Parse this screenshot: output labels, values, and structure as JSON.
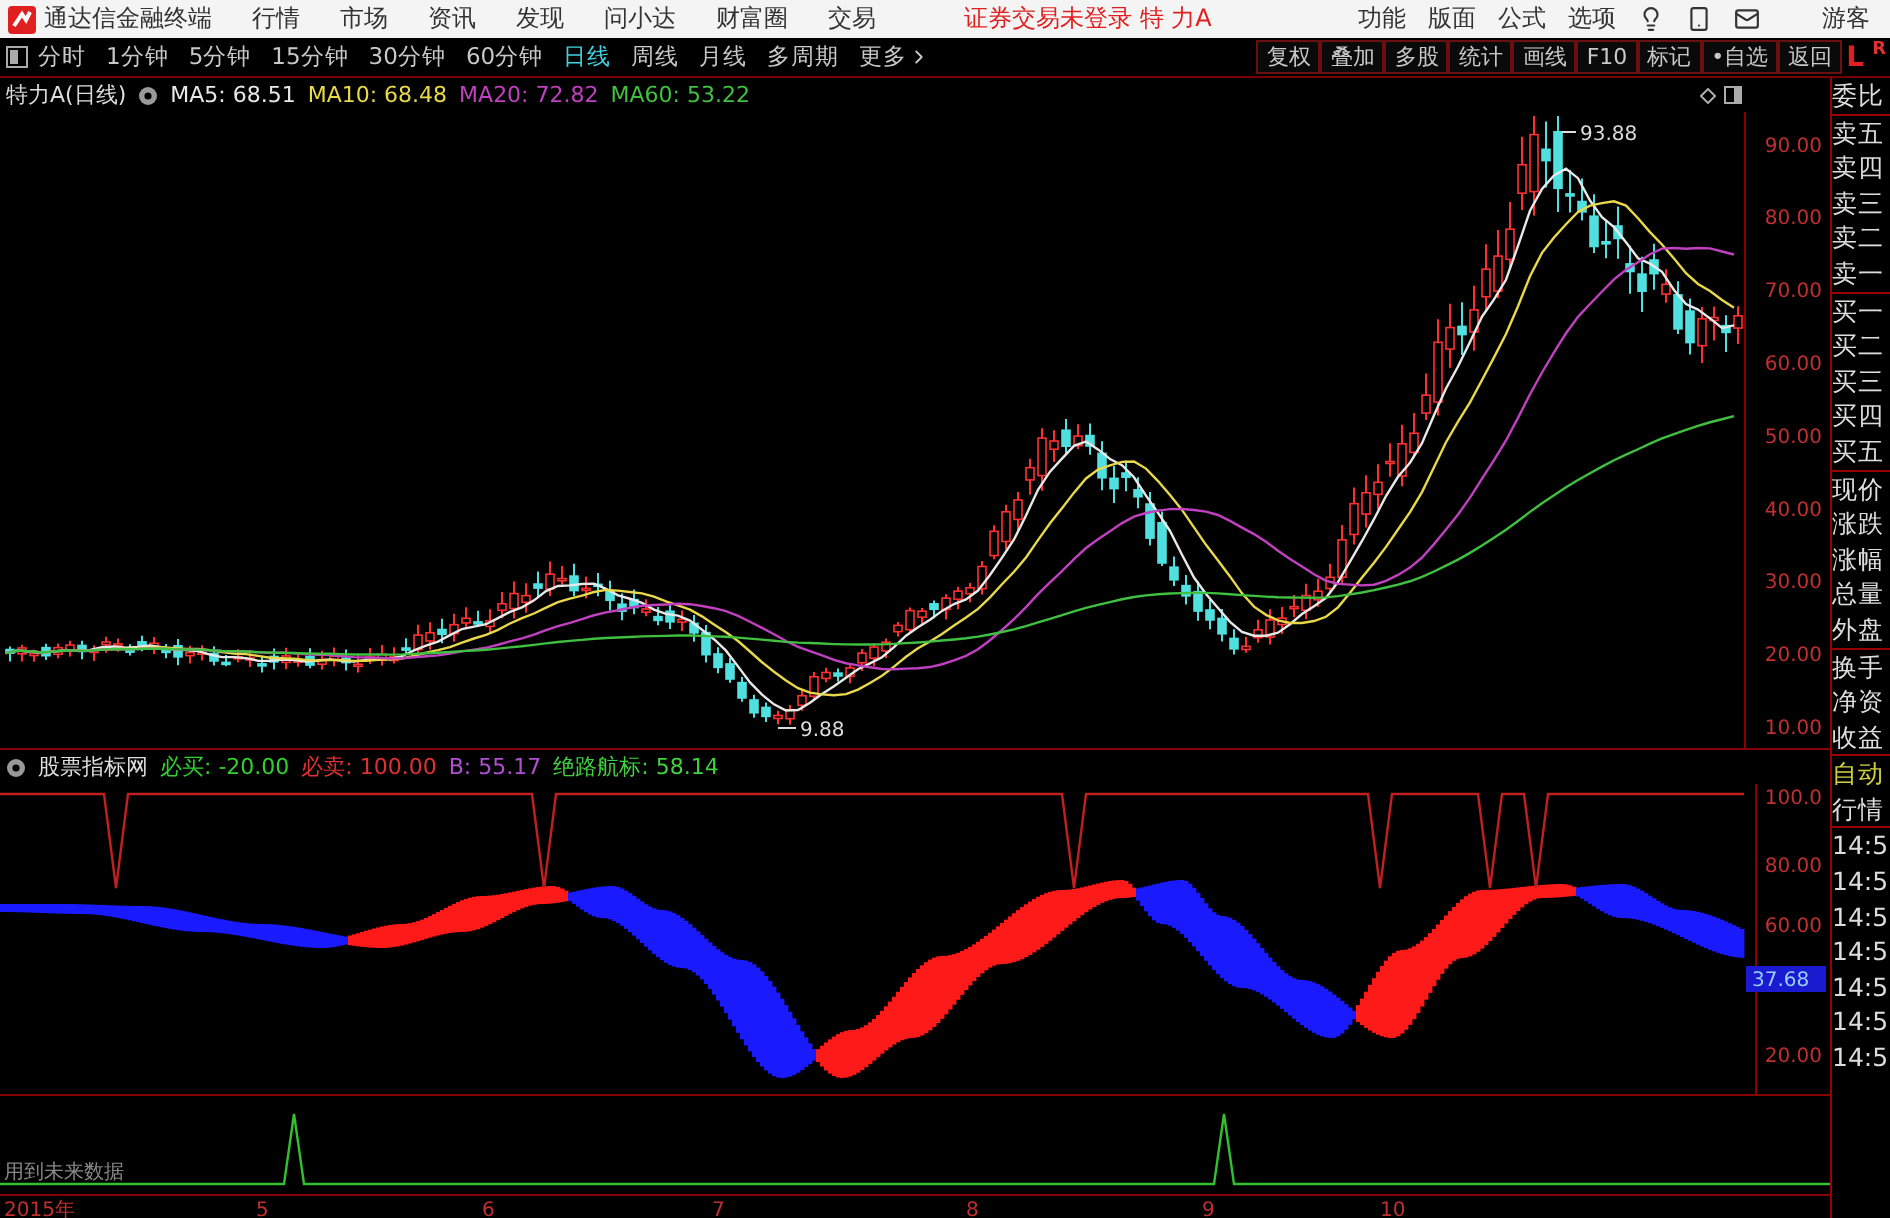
{
  "menu_bar": {
    "app_title": "通达信金融终端",
    "menus": [
      "行情",
      "市场",
      "资讯",
      "发现",
      "问小达",
      "财富圈",
      "交易"
    ],
    "login_status": "证券交易未登录 特 力A",
    "right_menus": [
      "功能",
      "版面",
      "公式",
      "选项"
    ],
    "user": "游客"
  },
  "period_tabs": [
    {
      "label": "分时",
      "selected": false
    },
    {
      "label": "1分钟",
      "selected": false
    },
    {
      "label": "5分钟",
      "selected": false
    },
    {
      "label": "15分钟",
      "selected": false
    },
    {
      "label": "30分钟",
      "selected": false
    },
    {
      "label": "60分钟",
      "selected": false
    },
    {
      "label": "日线",
      "selected": true
    },
    {
      "label": "周线",
      "selected": false
    },
    {
      "label": "月线",
      "selected": false
    },
    {
      "label": "多周期",
      "selected": false
    },
    {
      "label": "更多",
      "selected": false
    }
  ],
  "tool_buttons": [
    "复权",
    "叠加",
    "多股",
    "统计",
    "画线",
    "F10",
    "标记",
    "•自选",
    "返回"
  ],
  "panel_toggle": {
    "left": "L",
    "right": "R"
  },
  "price_chart": {
    "title": "特力A(日线)",
    "ma_legend": [
      {
        "label": "MA5: 68.51",
        "color": "#e8e8e8"
      },
      {
        "label": "MA10: 68.48",
        "color": "#e8d84a"
      },
      {
        "label": "MA20: 72.82",
        "color": "#c040c0"
      },
      {
        "label": "MA60: 53.22",
        "color": "#40c040"
      }
    ],
    "y_axis": [
      "90.00",
      "80.00",
      "70.00",
      "60.00",
      "50.00",
      "40.00",
      "30.00",
      "20.00",
      "10.00"
    ],
    "high_label": "93.88",
    "low_label": "9.88"
  },
  "indicator": {
    "name": "股票指标网",
    "legend": [
      {
        "label": "必买: -20.00",
        "color": "#30d030"
      },
      {
        "label": "必卖: 100.00",
        "color": "#e03030"
      },
      {
        "label": "B: 55.17",
        "color": "#b050d0"
      },
      {
        "label": "绝路航标: 58.14",
        "color": "#40d040"
      }
    ],
    "y_axis": [
      "100.0",
      "80.00",
      "60.00",
      "20.00"
    ],
    "current_value": "37.68"
  },
  "signal_panel": {
    "note": "用到未来数据"
  },
  "x_axis": [
    "2015年",
    "5",
    "6",
    "7",
    "8",
    "9",
    "10"
  ],
  "sidebar": {
    "groups": [
      [
        "委比"
      ],
      [
        "卖五",
        "卖四",
        "卖三",
        "卖二",
        "卖一"
      ],
      [
        "买一",
        "买二",
        "买三",
        "买四",
        "买五"
      ],
      [
        "现价",
        "涨跌",
        "涨幅",
        "总量",
        "外盘"
      ],
      [
        "换手",
        "净资",
        "收益"
      ]
    ],
    "status": [
      "自动",
      "行情"
    ],
    "time_rows": [
      "14:5",
      "14:5",
      "14:5",
      "14:5",
      "14:5",
      "14:5",
      "14:5"
    ]
  }
}
